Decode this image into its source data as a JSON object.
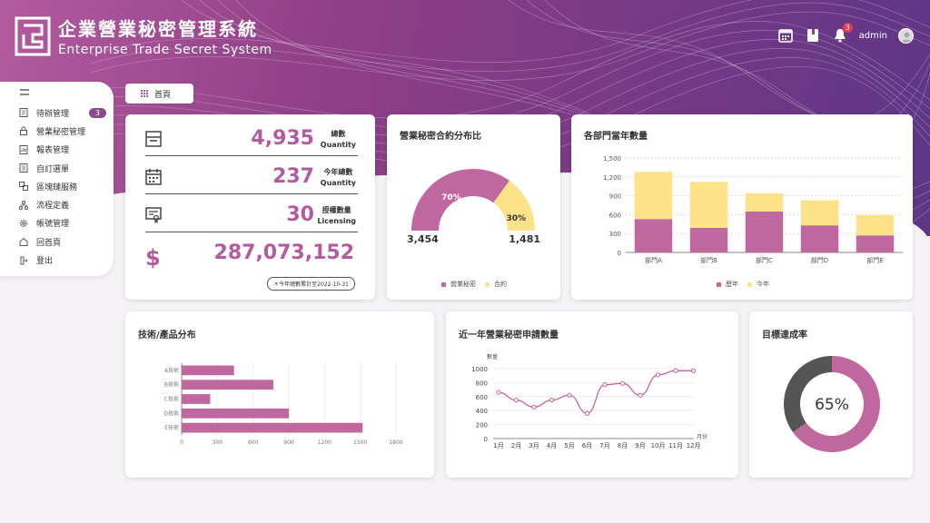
{
  "app": {
    "title_zh": "企業營業秘密管理系統",
    "title_en": "Enterprise Trade Secret System",
    "user": "admin",
    "notification_count": "3"
  },
  "sidebar": {
    "items": [
      {
        "label": "待辦管理",
        "icon": "todo-icon",
        "count": "3"
      },
      {
        "label": "營業秘密管理",
        "icon": "lock-icon"
      },
      {
        "label": "報表管理",
        "icon": "report-icon"
      },
      {
        "label": "自訂選單",
        "icon": "custom-menu-icon"
      },
      {
        "label": "區塊鏈服務",
        "icon": "blockchain-icon"
      },
      {
        "label": "流程定義",
        "icon": "flow-icon"
      },
      {
        "label": "帳號管理",
        "icon": "gear-icon"
      },
      {
        "label": "回首頁",
        "icon": "home-icon"
      },
      {
        "label": "登出",
        "icon": "logout-icon"
      }
    ]
  },
  "breadcrumb": {
    "label": "首頁"
  },
  "stats": {
    "total_value": "4,935",
    "total_zh": "總數",
    "total_en": "Quantity",
    "year_value": "237",
    "year_zh": "今年總數",
    "year_en": "Quantity",
    "license_value": "30",
    "license_zh": "授權數量",
    "license_en": "Licensing",
    "money_sign": "$",
    "money_value": "287,073,152",
    "note": "＊今年總數累計至2022-10-31"
  },
  "colors": {
    "primary": "#c0679f",
    "accent": "#fce38a",
    "dark": "#555555"
  },
  "charts": {
    "secret_contract": {
      "title": "營業秘密合約分布比",
      "left_value": "3,454",
      "right_value": "1,481",
      "left_pct": "70%",
      "right_pct": "30%",
      "legend": [
        "營業秘密",
        "合約"
      ]
    },
    "dept": {
      "title": "各部門當年數量",
      "legend": [
        "歷年",
        "今年"
      ],
      "yticks": [
        "1,500",
        "1,200",
        "900",
        "600",
        "300",
        "0"
      ]
    },
    "tech": {
      "title": "技術/產品分布",
      "xticks": [
        "0",
        "300",
        "600",
        "900",
        "1200",
        "1500",
        "1800"
      ]
    },
    "monthly": {
      "title": "近一年營業秘密申請數量",
      "ylabel": "數量",
      "xlabel": "月份",
      "yticks": [
        "1000",
        "800",
        "600",
        "400",
        "200",
        "0"
      ]
    },
    "target": {
      "title": "目標達成率",
      "value": "65%"
    }
  },
  "chart_data": [
    {
      "type": "pie",
      "title": "營業秘密合約分布比",
      "categories": [
        "營業秘密",
        "合約"
      ],
      "values": [
        3454,
        1481
      ],
      "percent_labels": [
        "70%",
        "30%"
      ]
    },
    {
      "type": "bar",
      "title": "各部門當年數量",
      "categories": [
        "部門A",
        "部門B",
        "部門C",
        "部門D",
        "部門E"
      ],
      "series": [
        {
          "name": "歷年",
          "values": [
            530,
            390,
            650,
            430,
            270
          ]
        },
        {
          "name": "今年",
          "values": [
            750,
            730,
            290,
            400,
            320
          ]
        }
      ],
      "ylim": [
        0,
        1500
      ],
      "stacked": true
    },
    {
      "type": "bar",
      "orientation": "horizontal",
      "title": "技術/產品分布",
      "categories": [
        "A技術",
        "B技術",
        "C技術",
        "D技術",
        "E技術"
      ],
      "values": [
        440,
        770,
        240,
        900,
        1520
      ],
      "xlim": [
        0,
        1800
      ]
    },
    {
      "type": "line",
      "title": "近一年營業秘密申請數量",
      "xlabel": "月份",
      "ylabel": "數量",
      "categories": [
        "1月",
        "2月",
        "3月",
        "4月",
        "5月",
        "6月",
        "7月",
        "8月",
        "9月",
        "10月",
        "11月",
        "12月"
      ],
      "values": [
        660,
        550,
        450,
        550,
        620,
        360,
        770,
        790,
        620,
        910,
        970,
        970
      ],
      "ylim": [
        0,
        1000
      ]
    },
    {
      "type": "pie",
      "title": "目標達成率",
      "values": [
        65,
        35
      ],
      "center_label": "65%"
    }
  ]
}
